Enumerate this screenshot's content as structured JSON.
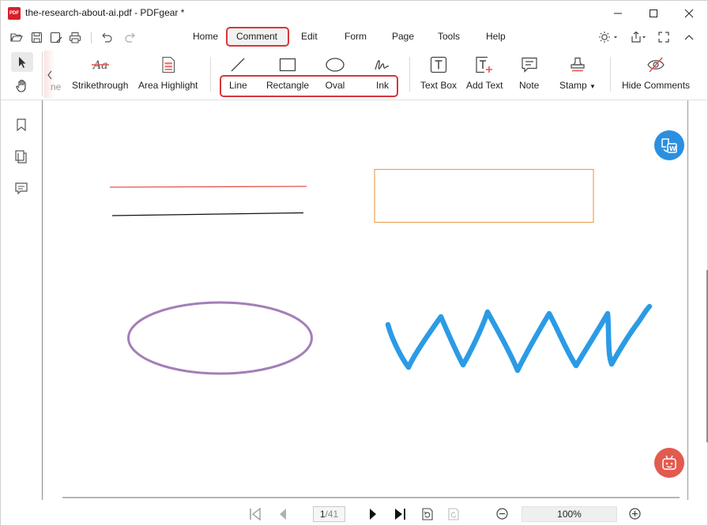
{
  "window": {
    "title": "the-research-about-ai.pdf - PDFgear *",
    "app_icon_text": "PDF"
  },
  "menu": {
    "items": [
      "Home",
      "Comment",
      "Edit",
      "Form",
      "Page",
      "Tools",
      "Help"
    ],
    "active": "Comment"
  },
  "ribbon": {
    "partial_label": "ne",
    "tools": {
      "strikethrough": "Strikethrough",
      "area_highlight": "Area Highlight",
      "line": "Line",
      "rectangle": "Rectangle",
      "oval": "Oval",
      "ink": "Ink",
      "text_box": "Text Box",
      "add_text": "Add Text",
      "note": "Note",
      "stamp": "Stamp",
      "hide_comments": "Hide Comments"
    }
  },
  "status": {
    "page_current": "1",
    "page_total": "/41",
    "zoom": "100%"
  },
  "colors": {
    "accent_red": "#d9353a",
    "line_red": "#e4534b",
    "rect_orange": "#e8a35a",
    "oval_purple": "#a37fb8",
    "ink_blue": "#2b9be6",
    "convert_button": "#2b8fe0",
    "ai_button": "#e35a4f"
  }
}
